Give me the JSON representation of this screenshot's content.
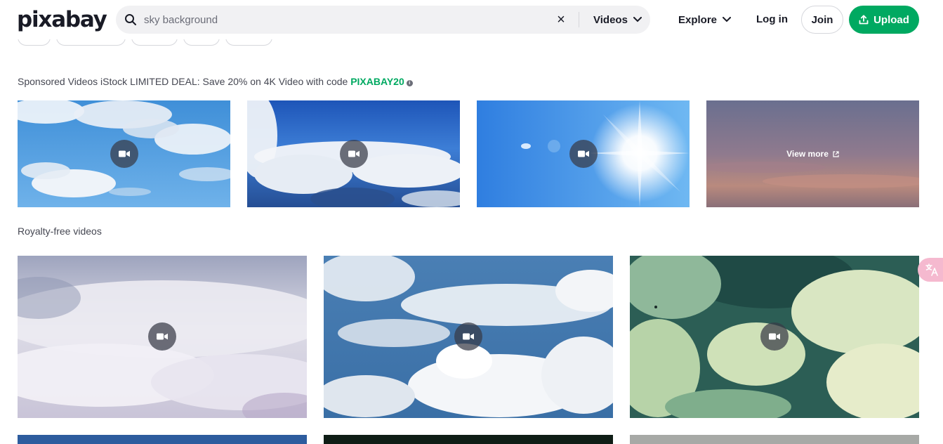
{
  "header": {
    "logo": "pixabay",
    "search": {
      "value": "sky background",
      "type_label": "Videos"
    },
    "explore_label": "Explore",
    "login_label": "Log in",
    "join_label": "Join",
    "upload_label": "Upload"
  },
  "sponsored": {
    "text": "Sponsored Videos iStock LIMITED DEAL: Save 20% on 4K Video with code ",
    "code": "PIXABAY20",
    "view_more": "View more"
  },
  "royalty_free_label": "Royalty-free videos",
  "colors": {
    "brand_green": "#00a961",
    "text_dark": "#191b26",
    "text_muted": "#454752"
  }
}
